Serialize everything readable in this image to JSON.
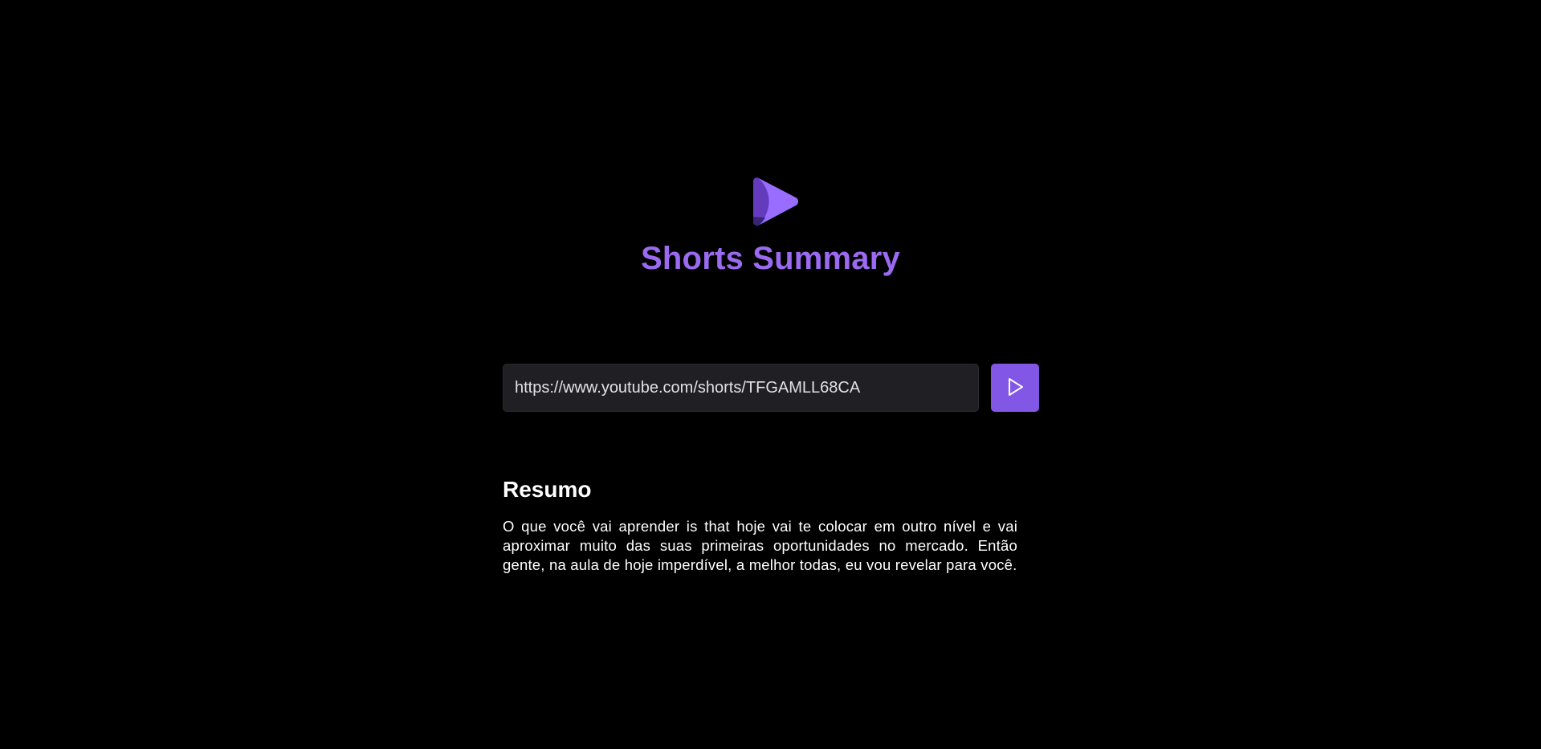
{
  "header": {
    "logo_icon": "play-logo-icon",
    "title": "Shorts Summary",
    "title_color": "#9a6af0"
  },
  "search": {
    "value": "https://www.youtube.com/shorts/TFGAMLL68CA",
    "submit_icon": "play-icon",
    "button_color": "#8257e5"
  },
  "summary": {
    "heading": "Resumo",
    "text": "O que você vai aprender is that hoje vai te colocar em outro nível e vai aproximar muito das suas primeiras oportunidades no mercado. Então gente, na aula de hoje imperdível, a melhor todas, eu vou revelar para você."
  }
}
